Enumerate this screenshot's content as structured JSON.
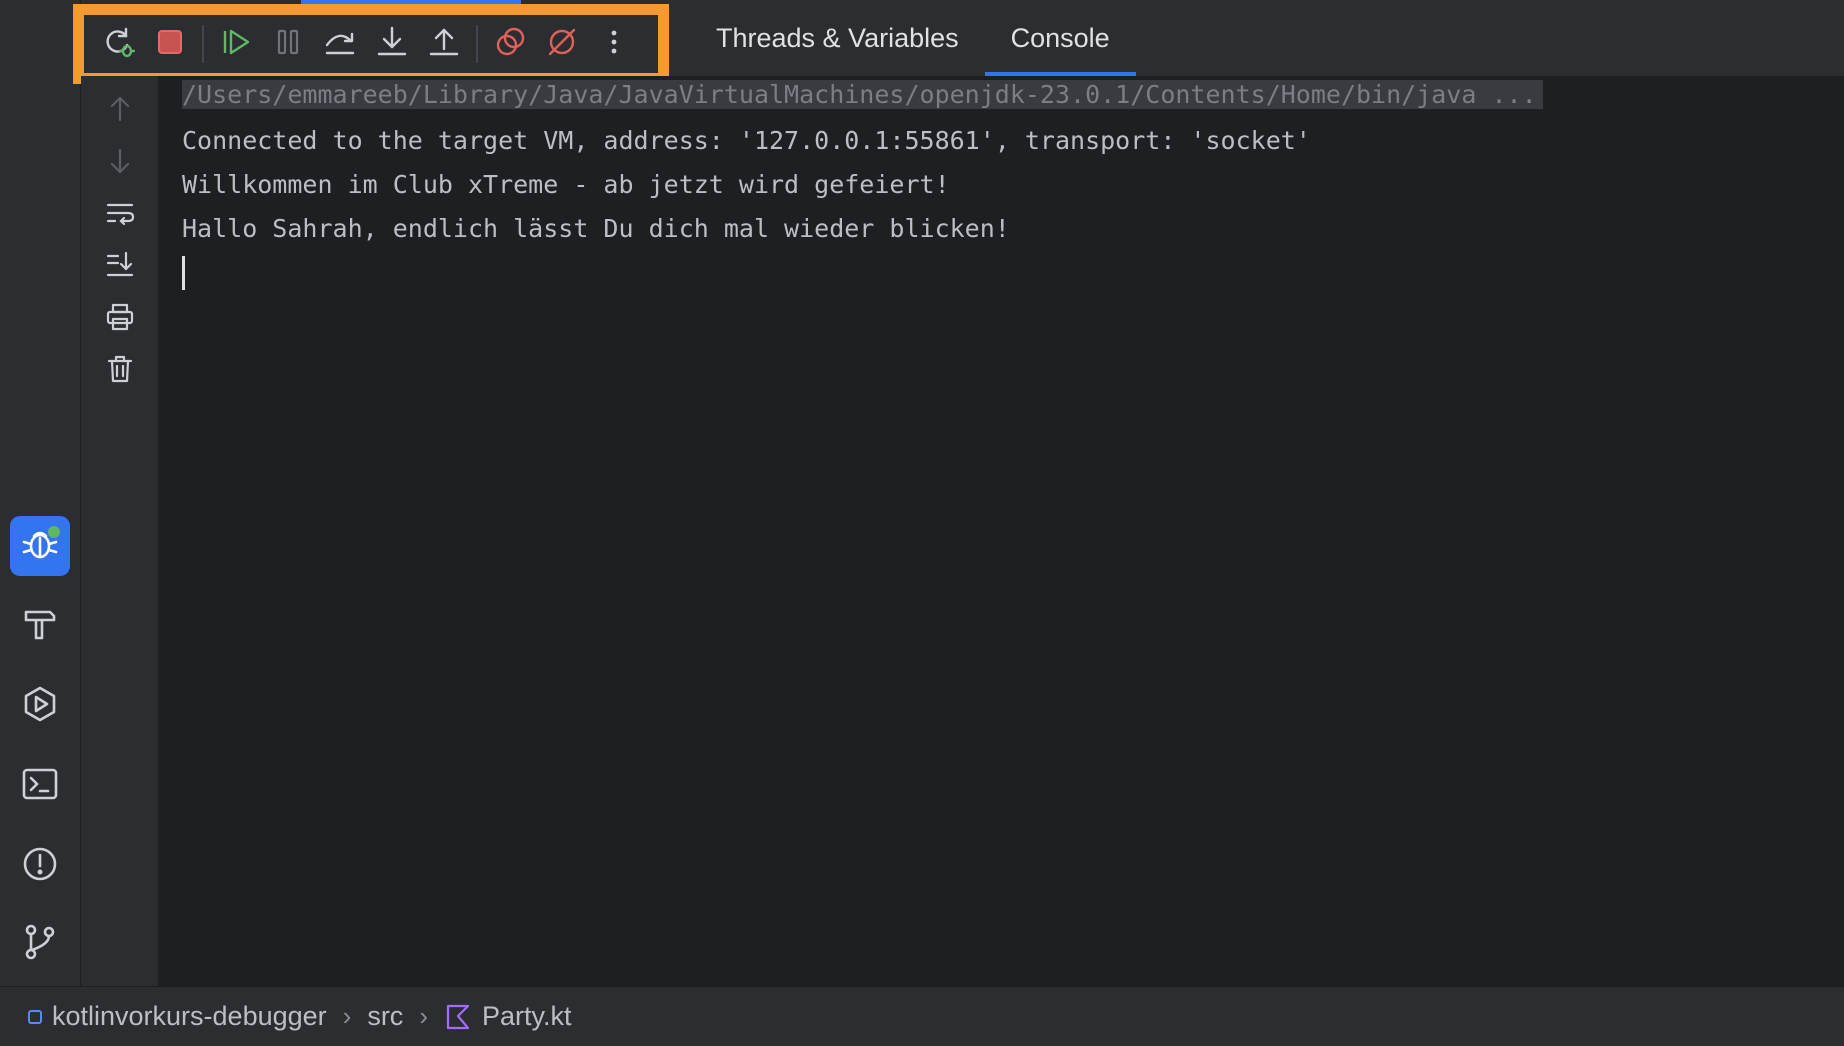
{
  "colors": {
    "accent": "#3574f0",
    "highlight_frame": "#f59a31",
    "stop_red": "#db5c5c",
    "resume_green": "#5fb865",
    "kotlin_purple": "#a36bff"
  },
  "toolbar": {
    "buttons": [
      {
        "icon": "rerun-debug-icon"
      },
      {
        "icon": "stop-icon"
      },
      {
        "icon": "resume-program-icon"
      },
      {
        "icon": "pause-program-icon"
      },
      {
        "icon": "step-over-icon"
      },
      {
        "icon": "step-into-icon"
      },
      {
        "icon": "step-out-icon"
      },
      {
        "icon": "view-breakpoints-icon"
      },
      {
        "icon": "mute-breakpoints-icon"
      },
      {
        "icon": "more-options-icon"
      }
    ]
  },
  "tabs": [
    {
      "label": "Threads & Variables",
      "selected": false
    },
    {
      "label": "Console",
      "selected": true
    }
  ],
  "console": {
    "lines": [
      "/Users/emmareeb/Library/Java/JavaVirtualMachines/openjdk-23.0.1/Contents/Home/bin/java ...",
      "Connected to the target VM, address: '127.0.0.1:55861', transport: 'socket'",
      "Willkommen im Club xTreme - ab jetzt wird gefeiert!",
      "Hallo Sahrah, endlich lässt Du dich mal wieder blicken!"
    ]
  },
  "console_side_actions": [
    {
      "icon": "up-arrow-icon"
    },
    {
      "icon": "down-arrow-icon"
    },
    {
      "icon": "soft-wrap-icon"
    },
    {
      "icon": "scroll-to-end-icon"
    },
    {
      "icon": "print-icon"
    },
    {
      "icon": "clear-all-icon"
    }
  ],
  "tool_window_bar": [
    {
      "icon": "debug-bug-icon",
      "active": true
    },
    {
      "icon": "build-hammer-icon",
      "active": false
    },
    {
      "icon": "services-icon",
      "active": false
    },
    {
      "icon": "terminal-icon",
      "active": false
    },
    {
      "icon": "problems-icon",
      "active": false
    },
    {
      "icon": "git-branch-icon",
      "active": false
    }
  ],
  "breadcrumb": {
    "project": "kotlinvorkurs-debugger",
    "folder": "src",
    "file": "Party.kt",
    "separator": "›"
  }
}
